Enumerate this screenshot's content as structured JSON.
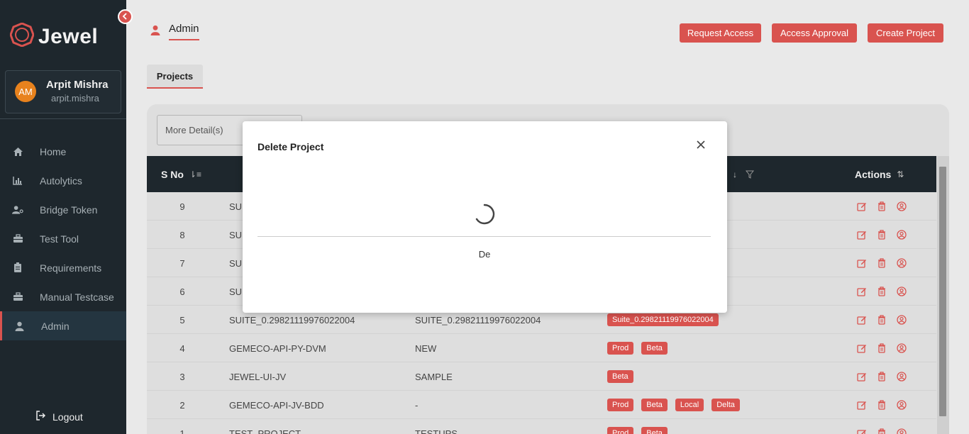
{
  "app": {
    "brand": "Jewel",
    "accent": "#d9534f"
  },
  "user": {
    "initials": "AM",
    "name": "Arpit Mishra",
    "handle": "arpit.mishra"
  },
  "sidebar": {
    "items": [
      {
        "label": "Home",
        "icon": "home-icon"
      },
      {
        "label": "Autolytics",
        "icon": "bar-chart-icon"
      },
      {
        "label": "Bridge Token",
        "icon": "user-key-icon"
      },
      {
        "label": "Test Tool",
        "icon": "toolbox-icon"
      },
      {
        "label": "Requirements",
        "icon": "clipboard-icon"
      },
      {
        "label": "Manual Testcase",
        "icon": "toolbox-icon"
      },
      {
        "label": "Admin",
        "icon": "user-icon",
        "active": true
      }
    ],
    "logout": "Logout"
  },
  "header": {
    "tab": "Admin",
    "buttons": {
      "request_access": "Request Access",
      "access_approval": "Access Approval",
      "create_project": "Create Project"
    }
  },
  "tabs": {
    "projects": "Projects"
  },
  "filter": {
    "more_details": "More Detail(s)"
  },
  "table": {
    "headers": {
      "sno": "S No",
      "actions": "Actions"
    },
    "rows": [
      {
        "sno": "9",
        "c1": "SUI",
        "c2": "",
        "tags": []
      },
      {
        "sno": "8",
        "c1": "SUI",
        "c2": "",
        "tags": []
      },
      {
        "sno": "7",
        "c1": "SUI",
        "c2": "",
        "tags": []
      },
      {
        "sno": "6",
        "c1": "SUI",
        "c2": "",
        "tags": []
      },
      {
        "sno": "5",
        "c1": "SUITE_0.29821119976022004",
        "c2": "SUITE_0.29821119976022004",
        "tags": [
          "Suite_0.29821119976022004"
        ]
      },
      {
        "sno": "4",
        "c1": "GEMECO-API-PY-DVM",
        "c2": "NEW",
        "tags": [
          "Prod",
          "Beta"
        ]
      },
      {
        "sno": "3",
        "c1": "JEWEL-UI-JV",
        "c2": "SAMPLE",
        "tags": [
          "Beta"
        ]
      },
      {
        "sno": "2",
        "c1": "GEMECO-API-JV-BDD",
        "c2": "-",
        "tags": [
          "Prod",
          "Beta",
          "Local",
          "Delta"
        ]
      },
      {
        "sno": "1",
        "c1": "TEST_PROJECT",
        "c2": "TESTUPS",
        "tags": [
          "Prod",
          "Beta"
        ]
      }
    ]
  },
  "modal": {
    "title": "Delete Project",
    "text": "De"
  }
}
